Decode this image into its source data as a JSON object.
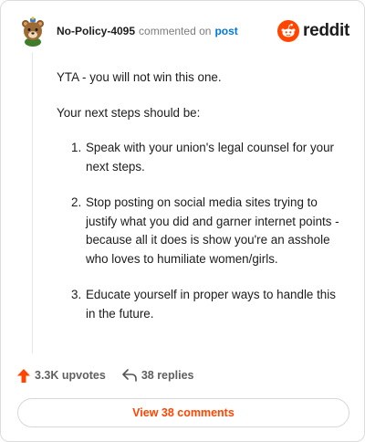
{
  "header": {
    "username": "No-Policy-4095",
    "commented_text": "commented on",
    "post_link": "post",
    "brand": "reddit",
    "brand_color": "#ff4500"
  },
  "comment": {
    "intro": "YTA - you will not win this one.",
    "lead": "Your next steps should be:",
    "steps": [
      {
        "num": "1.",
        "text": "Speak with your union's legal counsel for your next steps."
      },
      {
        "num": "2.",
        "text": "Stop posting on social media sites trying to justify what you did and garner internet points - because all it does is show you're an asshole who loves to humiliate women/girls."
      },
      {
        "num": "3.",
        "text": "Educate yourself in proper ways to handle this in the future."
      }
    ]
  },
  "actions": {
    "upvotes": "3.3K upvotes",
    "upvote_icon": "upvote-arrow-icon",
    "replies": "38 replies",
    "reply_icon": "reply-arrow-icon"
  },
  "footer": {
    "view_comments": "View 38 comments"
  }
}
